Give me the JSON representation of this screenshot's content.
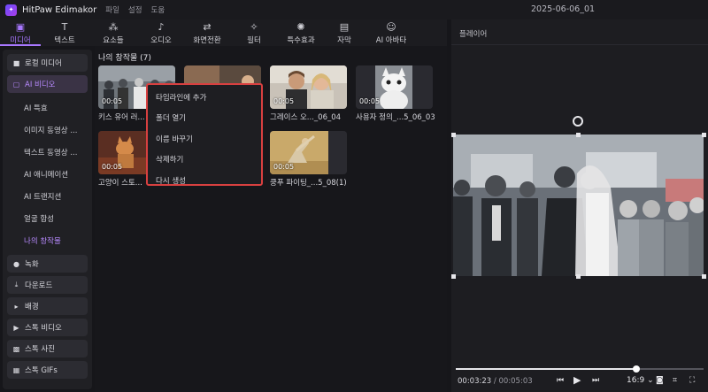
{
  "app": {
    "name": "HitPaw Edimakor",
    "menus": [
      "파일",
      "설정",
      "도움"
    ],
    "project_title": "2025-06-06_01"
  },
  "toolbar": {
    "tabs": [
      {
        "label": "미디어",
        "icon": "media-icon",
        "active": true
      },
      {
        "label": "텍스트",
        "icon": "text-icon",
        "active": false
      },
      {
        "label": "요소들",
        "icon": "elements-icon",
        "active": false
      },
      {
        "label": "오디오",
        "icon": "music-note-icon",
        "active": false
      },
      {
        "label": "화면전환",
        "icon": "transition-icon",
        "active": false
      },
      {
        "label": "필터",
        "icon": "filter-icon",
        "active": false
      },
      {
        "label": "특수효과",
        "icon": "effects-icon",
        "active": false
      },
      {
        "label": "자막",
        "icon": "subtitle-icon",
        "active": false
      },
      {
        "label": "AI 아바타",
        "icon": "avatar-icon",
        "active": false
      }
    ]
  },
  "sidebar": {
    "items_top": [
      {
        "label": "로컬 미디어",
        "icon": "folder-icon"
      },
      {
        "label": "AI 비디오",
        "icon": "ai-video-icon",
        "active": true
      }
    ],
    "sub_items": [
      {
        "label": "AI 특효"
      },
      {
        "label": "이미지 동영상 ..."
      },
      {
        "label": "텍스트 동영상 ..."
      },
      {
        "label": "AI 애니메이션"
      },
      {
        "label": "AI 트랜지션"
      },
      {
        "label": "얼굴 합성"
      },
      {
        "label": "나의 창작물",
        "active": true
      }
    ],
    "items_bottom": [
      {
        "label": "녹화",
        "icon": "record-icon"
      },
      {
        "label": "다운로드",
        "icon": "download-icon"
      },
      {
        "label": "배경",
        "icon": "background-icon"
      },
      {
        "label": "스톡 비디오",
        "icon": "stock-video-icon"
      },
      {
        "label": "스톡 사진",
        "icon": "stock-photo-icon"
      },
      {
        "label": "스톡 GIFs",
        "icon": "gif-icon"
      }
    ]
  },
  "media": {
    "title": "나의 창작물 (7)",
    "items": [
      {
        "duration": "00:05",
        "caption": "키스 유어 러..."
      },
      {
        "duration": "",
        "caption": ""
      },
      {
        "duration": "00:05",
        "caption": "그레이스 오..._06_04"
      },
      {
        "duration": "00:05",
        "caption": "사용자 정의_...5_06_03"
      },
      {
        "duration": "00:05",
        "caption": "고양이 스토..."
      },
      {
        "duration": "00:05",
        "caption": "쿵푸 파이팅_...5_08(1)"
      }
    ]
  },
  "context_menu": {
    "items": [
      "타임라인에 추가",
      "폴더 열기",
      "이름 바꾸기",
      "삭제하기",
      "다시 생성"
    ]
  },
  "player": {
    "title": "플레이어",
    "current_time": "00:03:23",
    "total_time": "/ 00:05:03",
    "progress": 0.73,
    "aspect_ratio": "16:9",
    "aspect_arrow": "⌄"
  }
}
